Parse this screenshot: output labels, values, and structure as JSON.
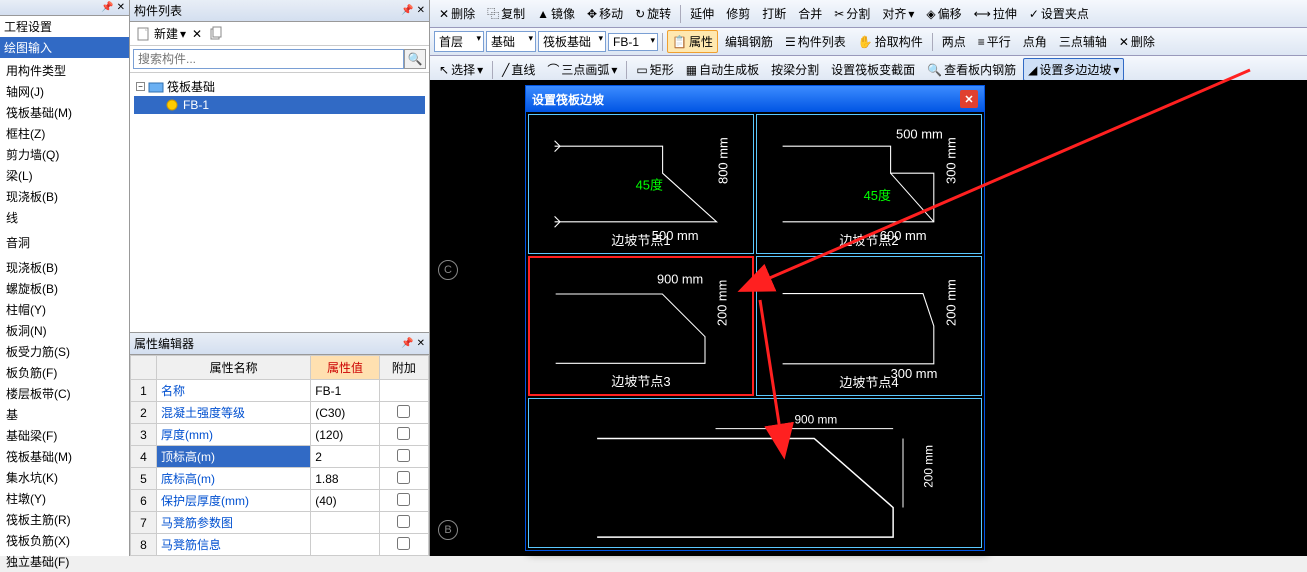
{
  "left_panel": {
    "header1": "工程设置",
    "header2": "绘图输入",
    "categories": [
      "用构件类型",
      "轴网(J)",
      "筏板基础(M)",
      "框柱(Z)",
      "剪力墙(Q)",
      "梁(L)",
      "现浇板(B)",
      "线",
      "",
      "音洞",
      "",
      "现浇板(B)",
      "螺旋板(B)",
      "柱帽(Y)",
      "板洞(N)",
      "板受力筋(S)",
      "板负筋(F)",
      "楼层板带(C)",
      "基",
      "基础梁(F)",
      "筏板基础(M)",
      "集水坑(K)",
      "柱墩(Y)",
      "筏板主筋(R)",
      "筏板负筋(X)",
      "独立基础(F)"
    ]
  },
  "mid_panel": {
    "title": "构件列表",
    "new_btn": "新建",
    "search_placeholder": "搜索构件...",
    "search_icon": "🔍",
    "tree": {
      "root": "筏板基础",
      "child": "FB-1"
    },
    "prop_title": "属性编辑器",
    "prop_headers": {
      "name": "属性名称",
      "value": "属性值",
      "extra": "附加"
    },
    "props": [
      {
        "n": "1",
        "name": "名称",
        "val": "FB-1",
        "chk": false
      },
      {
        "n": "2",
        "name": "混凝土强度等级",
        "val": "(C30)",
        "chk": true
      },
      {
        "n": "3",
        "name": "厚度(mm)",
        "val": "(120)",
        "chk": true
      },
      {
        "n": "4",
        "name": "顶标高(m)",
        "val": "2",
        "chk": true,
        "sel": true
      },
      {
        "n": "5",
        "name": "底标高(m)",
        "val": "1.88",
        "chk": true
      },
      {
        "n": "6",
        "name": "保护层厚度(mm)",
        "val": "(40)",
        "chk": true
      },
      {
        "n": "7",
        "name": "马凳筋参数图",
        "val": "",
        "chk": true
      },
      {
        "n": "8",
        "name": "马凳筋信息",
        "val": "",
        "chk": true
      }
    ]
  },
  "toolbars": {
    "row1": [
      "删除",
      "复制",
      "镜像",
      "移动",
      "旋转",
      "延伸",
      "修剪",
      "打断",
      "合并",
      "分割",
      "对齐",
      "偏移",
      "拉伸",
      "设置夹点"
    ],
    "row2_combos": [
      "首层",
      "基础",
      "筏板基础",
      "FB-1"
    ],
    "row2_btns": [
      "属性",
      "编辑钢筋",
      "构件列表",
      "拾取构件",
      "两点",
      "平行",
      "点角",
      "三点辅轴",
      "删除"
    ],
    "row3": [
      "选择",
      "直线",
      "三点画弧",
      "矩形",
      "自动生成板",
      "按梁分割",
      "设置筏板变截面",
      "查看板内钢筋",
      "设置多边边坡"
    ]
  },
  "dialog": {
    "title": "设置筏板边坡",
    "nodes": [
      "边坡节点1",
      "边坡节点2",
      "边坡节点3",
      "边坡节点4"
    ],
    "dims": {
      "n1": {
        "angle": "45度",
        "w": "500 mm",
        "h": "800 mm"
      },
      "n2": {
        "angle": "45度",
        "w": "600 mm",
        "top": "500 mm",
        "h": "300 mm"
      },
      "n3": {
        "w": "900 mm",
        "h": "200 mm"
      },
      "n4": {
        "w": "300 mm",
        "h": "200 mm"
      }
    },
    "preview": {
      "w": "900 mm",
      "h": "200 mm"
    }
  },
  "axis_labels": [
    "C",
    "B"
  ]
}
